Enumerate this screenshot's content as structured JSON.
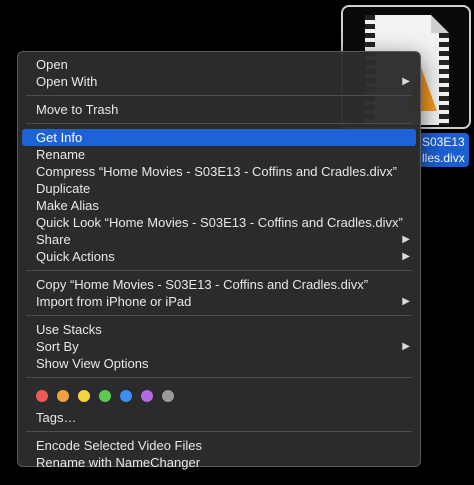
{
  "desktop": {
    "file_label_line1": "S03E13",
    "file_label_line2": "lles.divx"
  },
  "menu": {
    "group1": [
      {
        "label": "Open",
        "submenu": false
      },
      {
        "label": "Open With",
        "submenu": true
      }
    ],
    "group2": [
      {
        "label": "Move to Trash",
        "submenu": false
      }
    ],
    "group3": [
      {
        "label": "Get Info",
        "submenu": false,
        "selected": true
      },
      {
        "label": "Rename",
        "submenu": false
      },
      {
        "label": "Compress “Home Movies - S03E13 - Coffins and Cradles.divx”",
        "submenu": false
      },
      {
        "label": "Duplicate",
        "submenu": false
      },
      {
        "label": "Make Alias",
        "submenu": false
      },
      {
        "label": "Quick Look “Home Movies - S03E13 - Coffins and Cradles.divx”",
        "submenu": false
      },
      {
        "label": "Share",
        "submenu": true
      },
      {
        "label": "Quick Actions",
        "submenu": true
      }
    ],
    "group4": [
      {
        "label": "Copy “Home Movies - S03E13 - Coffins and Cradles.divx”",
        "submenu": false
      },
      {
        "label": "Import from iPhone or iPad",
        "submenu": true
      }
    ],
    "group5": [
      {
        "label": "Use Stacks",
        "submenu": false
      },
      {
        "label": "Sort By",
        "submenu": true
      },
      {
        "label": "Show View Options",
        "submenu": false
      }
    ],
    "tag_colors": [
      "#ee5b56",
      "#f1a23c",
      "#f5d53c",
      "#5cc94f",
      "#3c8ef2",
      "#b36ae2",
      "#9a9a9c"
    ],
    "tags_label": "Tags…",
    "group6": [
      {
        "label": "Encode Selected Video Files",
        "submenu": false
      },
      {
        "label": "Rename with NameChanger",
        "submenu": false
      }
    ],
    "submenu_arrow": "▶"
  }
}
